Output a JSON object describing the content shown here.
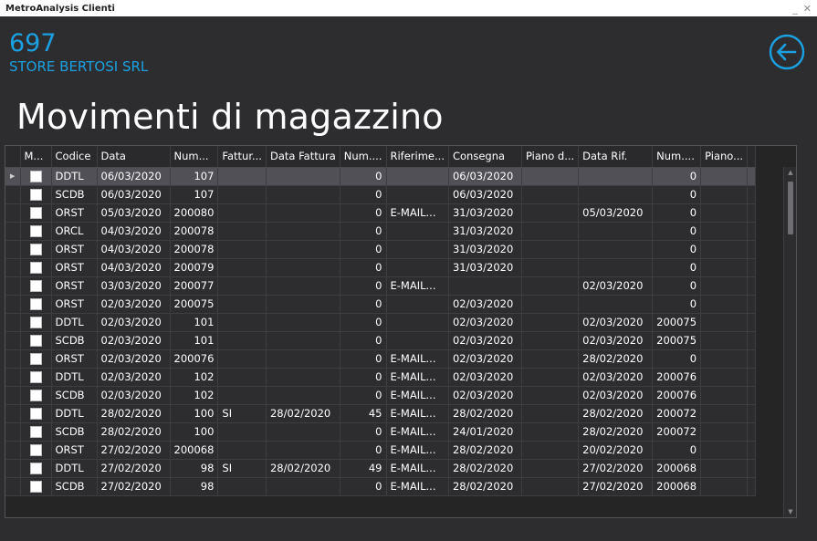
{
  "window": {
    "title": "MetroAnalysis Clienti",
    "minimize": "_",
    "close": "✕"
  },
  "store": {
    "code": "697",
    "name": "STORE BERTOSI SRL"
  },
  "page": {
    "title": "Movimenti di magazzino"
  },
  "colors": {
    "accent": "#1ba1e2",
    "background": "#2d2d30",
    "selected_row": "#505056"
  },
  "icons": {
    "back": "arrow-left-circle-icon"
  },
  "grid": {
    "columns": [
      "M...",
      "Codice",
      "Data",
      "Num...",
      "Fattur...",
      "Data Fattura",
      "Num....",
      "Riferime...",
      "Consegna",
      "Piano d...",
      "Data Rif.",
      "Num....",
      "Piano..."
    ],
    "rows": [
      {
        "codice": "DDTL",
        "data": "06/03/2020",
        "num": "107",
        "fattura": "",
        "data_fattura": "",
        "num2": "0",
        "riferimento": "",
        "consegna": "06/03/2020",
        "piano": "",
        "data_rif": "",
        "num3": "0",
        "piano2": ""
      },
      {
        "codice": "SCDB",
        "data": "06/03/2020",
        "num": "107",
        "fattura": "",
        "data_fattura": "",
        "num2": "0",
        "riferimento": "",
        "consegna": "06/03/2020",
        "piano": "",
        "data_rif": "",
        "num3": "0",
        "piano2": ""
      },
      {
        "codice": "ORST",
        "data": "05/03/2020",
        "num": "200080",
        "fattura": "",
        "data_fattura": "",
        "num2": "0",
        "riferimento": "E-MAIL...",
        "consegna": "31/03/2020",
        "piano": "",
        "data_rif": "05/03/2020",
        "num3": "0",
        "piano2": ""
      },
      {
        "codice": "ORCL",
        "data": "04/03/2020",
        "num": "200078",
        "fattura": "",
        "data_fattura": "",
        "num2": "0",
        "riferimento": "",
        "consegna": "31/03/2020",
        "piano": "",
        "data_rif": "",
        "num3": "0",
        "piano2": ""
      },
      {
        "codice": "ORST",
        "data": "04/03/2020",
        "num": "200078",
        "fattura": "",
        "data_fattura": "",
        "num2": "0",
        "riferimento": "",
        "consegna": "31/03/2020",
        "piano": "",
        "data_rif": "",
        "num3": "0",
        "piano2": ""
      },
      {
        "codice": "ORST",
        "data": "04/03/2020",
        "num": "200079",
        "fattura": "",
        "data_fattura": "",
        "num2": "0",
        "riferimento": "",
        "consegna": "31/03/2020",
        "piano": "",
        "data_rif": "",
        "num3": "0",
        "piano2": ""
      },
      {
        "codice": "ORST",
        "data": "03/03/2020",
        "num": "200077",
        "fattura": "",
        "data_fattura": "",
        "num2": "0",
        "riferimento": "E-MAIL...",
        "consegna": "",
        "piano": "",
        "data_rif": "02/03/2020",
        "num3": "0",
        "piano2": ""
      },
      {
        "codice": "ORST",
        "data": "02/03/2020",
        "num": "200075",
        "fattura": "",
        "data_fattura": "",
        "num2": "0",
        "riferimento": "",
        "consegna": "02/03/2020",
        "piano": "",
        "data_rif": "",
        "num3": "0",
        "piano2": ""
      },
      {
        "codice": "DDTL",
        "data": "02/03/2020",
        "num": "101",
        "fattura": "",
        "data_fattura": "",
        "num2": "0",
        "riferimento": "",
        "consegna": "02/03/2020",
        "piano": "",
        "data_rif": "02/03/2020",
        "num3": "200075",
        "piano2": ""
      },
      {
        "codice": "SCDB",
        "data": "02/03/2020",
        "num": "101",
        "fattura": "",
        "data_fattura": "",
        "num2": "0",
        "riferimento": "",
        "consegna": "02/03/2020",
        "piano": "",
        "data_rif": "02/03/2020",
        "num3": "200075",
        "piano2": ""
      },
      {
        "codice": "ORST",
        "data": "02/03/2020",
        "num": "200076",
        "fattura": "",
        "data_fattura": "",
        "num2": "0",
        "riferimento": "E-MAIL...",
        "consegna": "02/03/2020",
        "piano": "",
        "data_rif": "28/02/2020",
        "num3": "0",
        "piano2": ""
      },
      {
        "codice": "DDTL",
        "data": "02/03/2020",
        "num": "102",
        "fattura": "",
        "data_fattura": "",
        "num2": "0",
        "riferimento": "E-MAIL...",
        "consegna": "02/03/2020",
        "piano": "",
        "data_rif": "02/03/2020",
        "num3": "200076",
        "piano2": ""
      },
      {
        "codice": "SCDB",
        "data": "02/03/2020",
        "num": "102",
        "fattura": "",
        "data_fattura": "",
        "num2": "0",
        "riferimento": "E-MAIL...",
        "consegna": "02/03/2020",
        "piano": "",
        "data_rif": "02/03/2020",
        "num3": "200076",
        "piano2": ""
      },
      {
        "codice": "DDTL",
        "data": "28/02/2020",
        "num": "100",
        "fattura": "SI",
        "data_fattura": "28/02/2020",
        "num2": "45",
        "riferimento": "E-MAIL...",
        "consegna": "28/02/2020",
        "piano": "",
        "data_rif": "28/02/2020",
        "num3": "200072",
        "piano2": ""
      },
      {
        "codice": "SCDB",
        "data": "28/02/2020",
        "num": "100",
        "fattura": "",
        "data_fattura": "",
        "num2": "0",
        "riferimento": "E-MAIL...",
        "consegna": "24/01/2020",
        "piano": "",
        "data_rif": "28/02/2020",
        "num3": "200072",
        "piano2": ""
      },
      {
        "codice": "ORST",
        "data": "27/02/2020",
        "num": "200068",
        "fattura": "",
        "data_fattura": "",
        "num2": "0",
        "riferimento": "E-MAIL...",
        "consegna": "28/02/2020",
        "piano": "",
        "data_rif": "20/02/2020",
        "num3": "0",
        "piano2": ""
      },
      {
        "codice": "DDTL",
        "data": "27/02/2020",
        "num": "98",
        "fattura": "SI",
        "data_fattura": "28/02/2020",
        "num2": "49",
        "riferimento": "E-MAIL...",
        "consegna": "28/02/2020",
        "piano": "",
        "data_rif": "27/02/2020",
        "num3": "200068",
        "piano2": ""
      },
      {
        "codice": "SCDB",
        "data": "27/02/2020",
        "num": "98",
        "fattura": "",
        "data_fattura": "",
        "num2": "0",
        "riferimento": "E-MAIL...",
        "consegna": "28/02/2020",
        "piano": "",
        "data_rif": "27/02/2020",
        "num3": "200068",
        "piano2": ""
      }
    ],
    "selected_row": 0,
    "row_indicator": "▶"
  }
}
